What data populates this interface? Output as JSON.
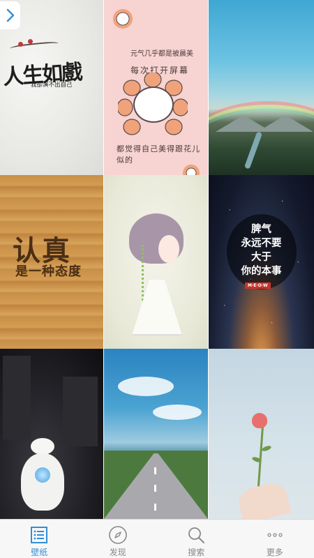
{
  "wallpapers": {
    "tile1": {
      "title": "人生如戲",
      "caption": "我卻演不出自己"
    },
    "tile2": {
      "line1": "元气几乎都是被晨美",
      "line2": "每次打开屏幕",
      "line3": "都觉得自己美得跟花儿似的"
    },
    "tile4": {
      "title": "认真",
      "subtitle": "是一种态度"
    },
    "tile6": {
      "lines": [
        "脾气",
        "永远不要",
        "大于",
        "你的本事"
      ],
      "tag": "M·E·O·W"
    }
  },
  "tabbar": {
    "items": [
      {
        "label": "壁纸",
        "icon": "wallpaper-list-icon",
        "active": true
      },
      {
        "label": "发现",
        "icon": "compass-icon",
        "active": false
      },
      {
        "label": "搜索",
        "icon": "search-icon",
        "active": false
      },
      {
        "label": "更多",
        "icon": "more-dots-icon",
        "active": false
      }
    ]
  },
  "colors": {
    "accent": "#2f8fd8",
    "inactive": "#888888"
  }
}
